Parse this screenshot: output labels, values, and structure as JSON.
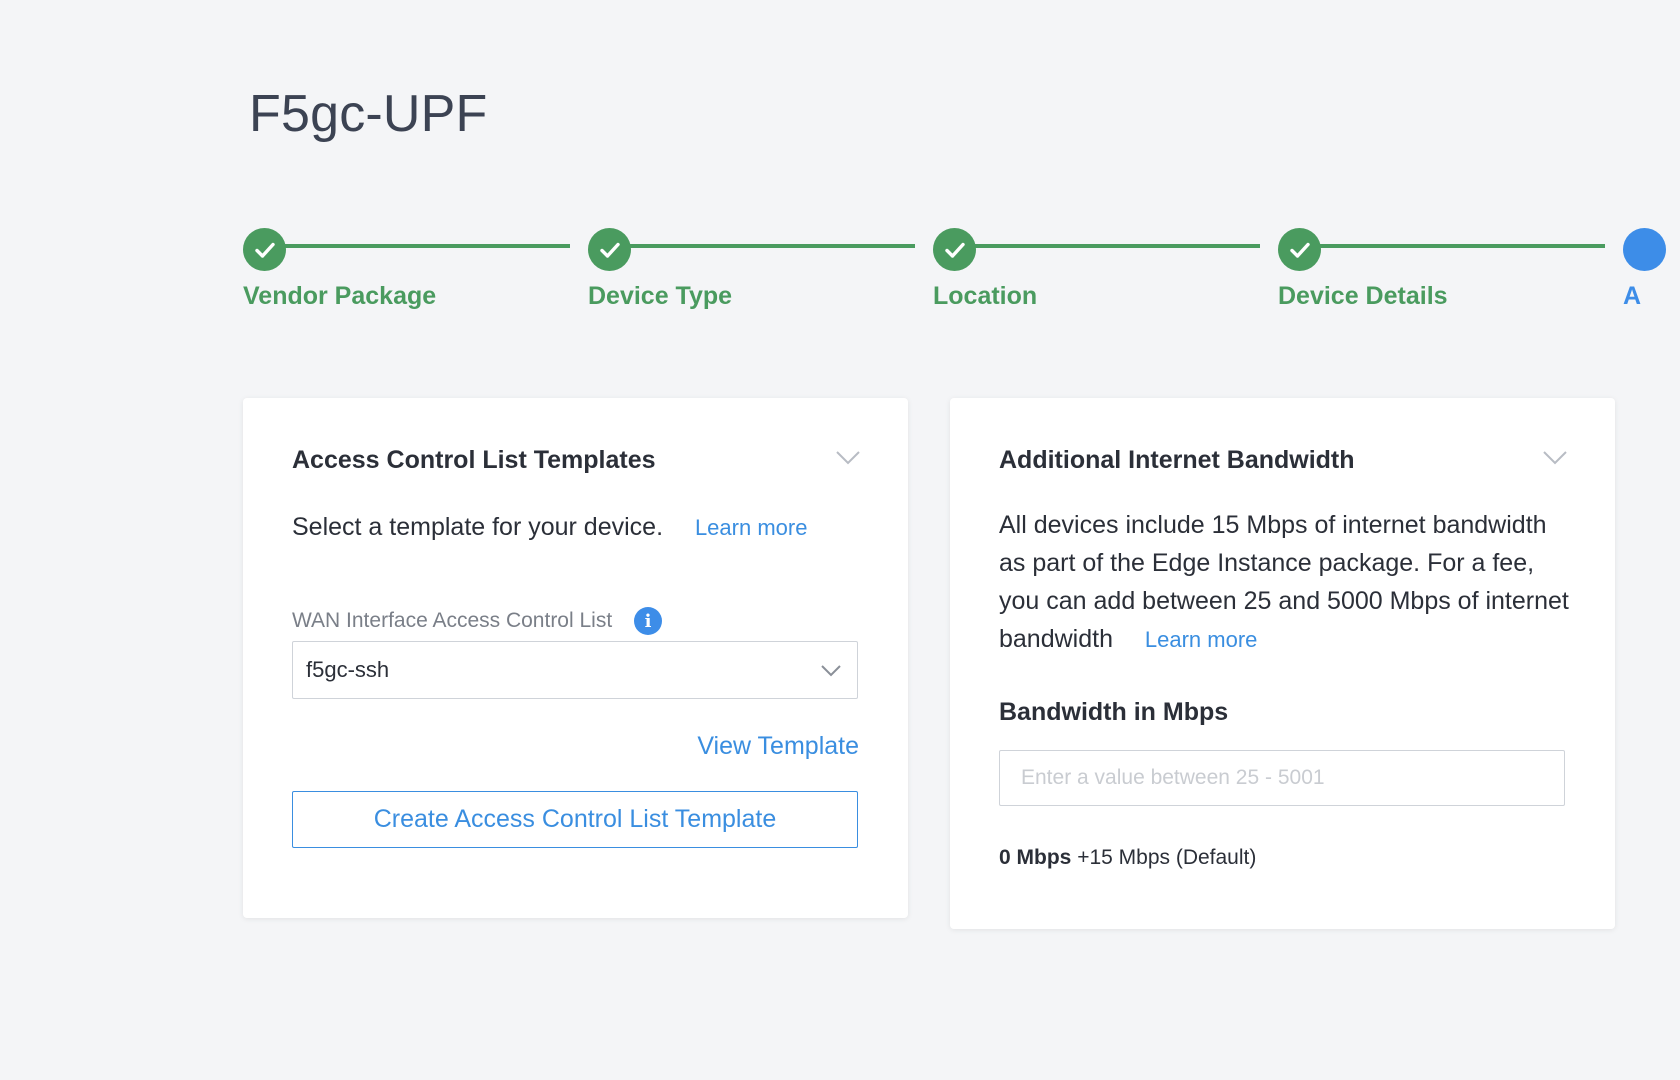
{
  "page": {
    "title": "F5gc-UPF"
  },
  "stepper": {
    "steps": [
      {
        "label": "Vendor Package",
        "status": "complete"
      },
      {
        "label": "Device Type",
        "status": "complete"
      },
      {
        "label": "Location",
        "status": "complete"
      },
      {
        "label": "Device Details",
        "status": "complete"
      },
      {
        "label": "A",
        "status": "active"
      }
    ],
    "complete_color": "#4a9b5f",
    "active_color": "#3d8de8"
  },
  "acl_card": {
    "title": "Access Control List Templates",
    "description": "Select a template for your device.",
    "learn_more": "Learn more",
    "field_label": "WAN Interface Access Control List",
    "selected_value": "f5gc-ssh",
    "view_template": "View Template",
    "create_button": "Create Access Control List Template"
  },
  "bandwidth_card": {
    "title": "Additional Internet Bandwidth",
    "description": "All devices include 15 Mbps of internet bandwidth as part of the Edge Instance package. For a fee, you can add between 25 and 5000 Mbps of internet bandwidth",
    "learn_more": "Learn more",
    "subheading": "Bandwidth in Mbps",
    "input_placeholder": "Enter a value between 25 - 5001",
    "input_value": "",
    "mbps_value": "0 Mbps",
    "mbps_suffix": "+15 Mbps (Default)"
  },
  "colors": {
    "link": "#3a8ee0",
    "background": "#f4f5f7"
  }
}
